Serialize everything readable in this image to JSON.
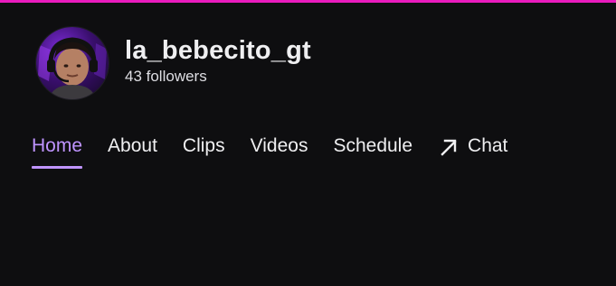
{
  "channel": {
    "name": "la_bebecito_gt",
    "followers": "43 followers"
  },
  "nav": {
    "tabs": [
      {
        "label": "Home",
        "active": true
      },
      {
        "label": "About",
        "active": false
      },
      {
        "label": "Clips",
        "active": false
      },
      {
        "label": "Videos",
        "active": false
      },
      {
        "label": "Schedule",
        "active": false
      },
      {
        "label": "Chat",
        "active": false,
        "icon": "external-arrow-icon"
      }
    ]
  },
  "colors": {
    "background": "#0e0e10",
    "accent": "#bf94ff",
    "top_strip": "#e91bbd",
    "text": "#efeff1"
  }
}
